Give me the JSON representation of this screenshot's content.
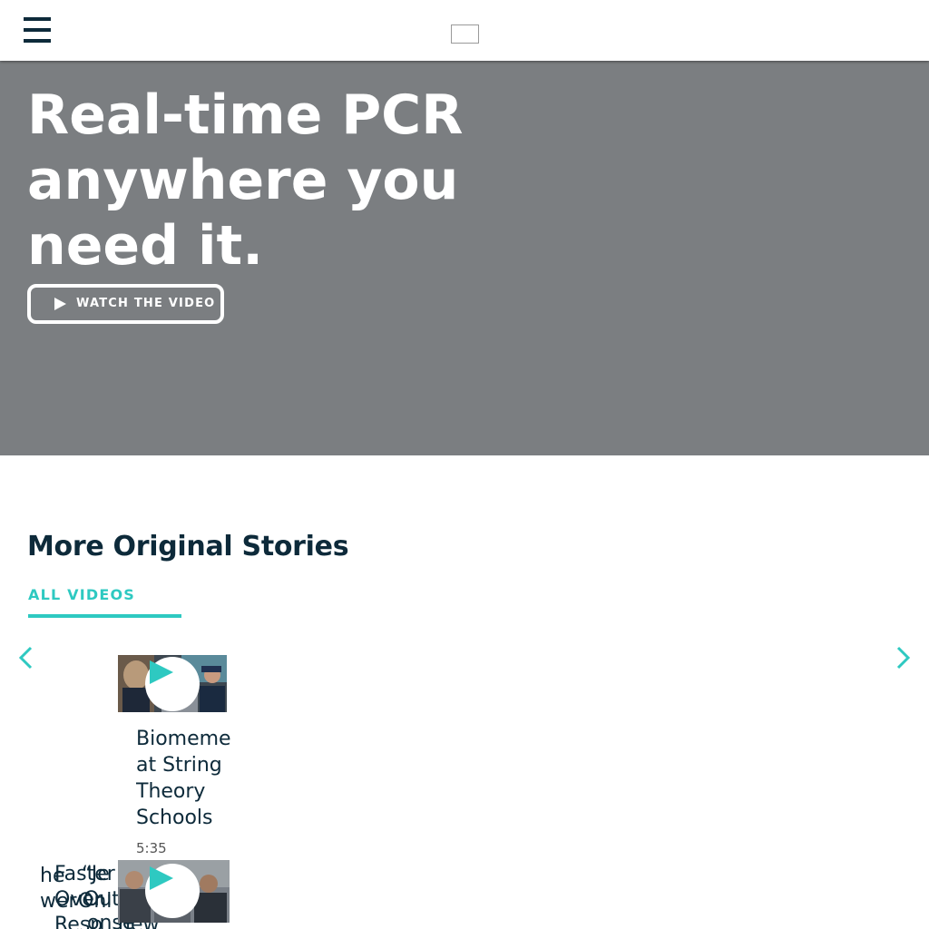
{
  "header": {
    "menu_icon": "hamburger-menu-icon",
    "logo_icon": "logo-placeholder-icon"
  },
  "hero": {
    "title": "Real-time PCR anywhere you need it.",
    "watch_button_label": "WATCH THE VIDEO",
    "play_icon": "play-icon"
  },
  "stories": {
    "title": "More Original Stories",
    "all_videos_label": "ALL VIDEOS",
    "prev_icon": "chevron-left-icon",
    "next_icon": "chevron-right-icon",
    "cards": [
      {
        "title": "Biomeme at String Theory Schools",
        "duration": "5:35"
      }
    ],
    "overlapping_text": [
      "he",
      "Faster",
      "“Je",
      "wer",
      "Over",
      "Out",
      "Onl",
      "Resp",
      "onse",
      "new"
    ]
  },
  "colors": {
    "accent": "#2ec9c1",
    "navy": "#0d2a3a",
    "hero_bg": "#7b7e81"
  }
}
